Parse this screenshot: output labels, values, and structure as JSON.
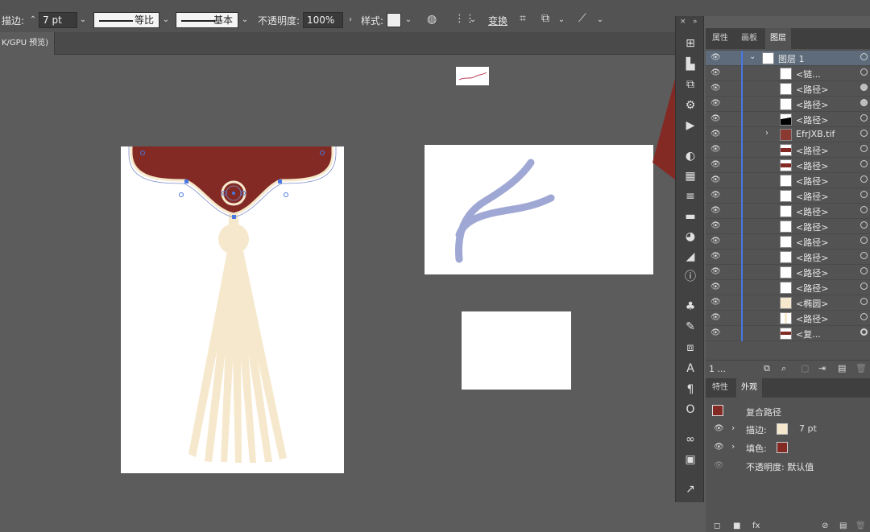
{
  "control_bar": {
    "stroke_label": "描边:",
    "stroke_value": "7 pt",
    "profile1_label": "等比",
    "profile2_label": "基本",
    "opacity_label": "不透明度:",
    "opacity_value": "100%",
    "style_label": "样式:",
    "transform_label": "变换"
  },
  "document_tab": {
    "label": "K/GPU 预览)"
  },
  "layers_panel": {
    "tabs": [
      "属性",
      "画板",
      "图层"
    ],
    "active_tab": "图层",
    "rows": [
      {
        "name": "图层 1",
        "selected": true
      },
      {
        "name": "<链..."
      },
      {
        "name": "<路径>"
      },
      {
        "name": "<路径>"
      },
      {
        "name": "<路径>"
      },
      {
        "name": "EfrJXB.tif"
      },
      {
        "name": "<路径>"
      },
      {
        "name": "<路径>"
      },
      {
        "name": "<路径>"
      },
      {
        "name": "<路径>"
      },
      {
        "name": "<路径>"
      },
      {
        "name": "<路径>"
      },
      {
        "name": "<路径>"
      },
      {
        "name": "<路径>"
      },
      {
        "name": "<路径>"
      },
      {
        "name": "<路径>"
      },
      {
        "name": "<椭圆>"
      },
      {
        "name": "<路径>"
      },
      {
        "name": "<复..."
      }
    ],
    "footer_count": "1 ..."
  },
  "appearance_panel": {
    "tabs": [
      "特性",
      "外观"
    ],
    "active_tab": "外观",
    "object_type": "复合路径",
    "stroke_label": "描边:",
    "stroke_value": "7 pt",
    "fill_label": "填色:",
    "opacity_row": "不透明度: 默认值"
  },
  "colors": {
    "maroon": "#832a24",
    "tassel": "#f6e8cc",
    "blue_stroke": "#9fa8d4",
    "layer_bar": "#4a78e0"
  }
}
